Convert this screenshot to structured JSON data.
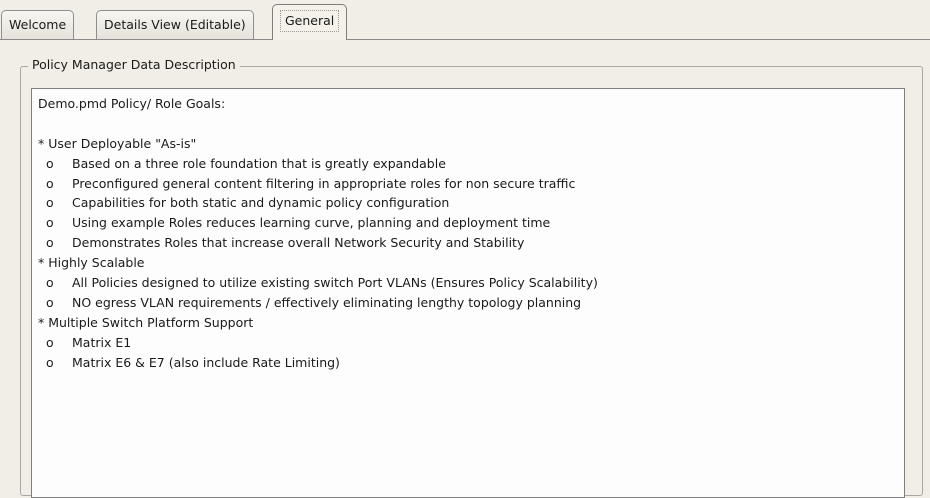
{
  "tabs": [
    {
      "label": "Welcome"
    },
    {
      "label": "Details View (Editable)"
    },
    {
      "label": "General"
    }
  ],
  "group": {
    "title": "Policy Manager Data Description"
  },
  "description": {
    "lines": [
      "Demo.pmd Policy/ Role Goals:",
      "",
      "* User Deployable \"As-is\"",
      "Based on a three role foundation that is greatly expandable",
      "Preconfigured general content filtering in appropriate roles for non secure traffic",
      "Capabilities for both static and dynamic policy configuration",
      "Using example Roles reduces learning curve, planning and deployment time",
      "Demonstrates Roles that increase overall Network Security and Stability",
      "* Highly Scalable",
      "All Policies designed to utilize existing switch Port VLANs (Ensures Policy Scalability)",
      "NO egress VLAN requirements / effectively eliminating lengthy topology planning",
      "* Multiple Switch Platform Support",
      "Matrix E1",
      "Matrix E6 & E7 (also include Rate Limiting)"
    ]
  }
}
